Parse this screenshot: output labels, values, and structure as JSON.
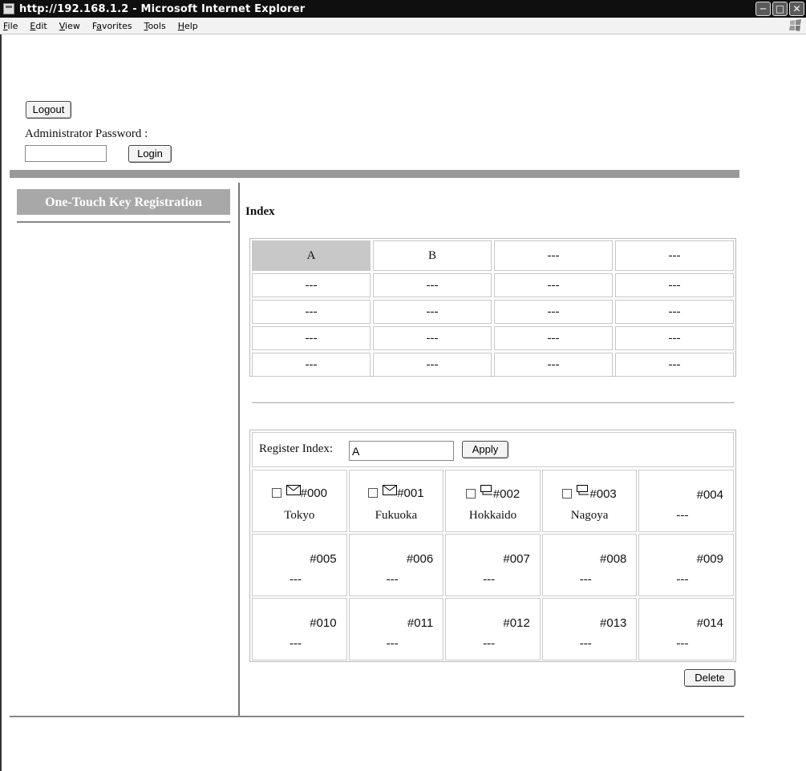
{
  "window": {
    "title": "http://192.168.1.2 - Microsoft Internet Explorer",
    "menu": [
      "File",
      "Edit",
      "View",
      "Favorites",
      "Tools",
      "Help"
    ],
    "menu_underline": [
      "F",
      "E",
      "V",
      "a",
      "T",
      "H"
    ]
  },
  "auth": {
    "logout_label": "Logout",
    "password_label": "Administrator Password :",
    "password_value": "",
    "login_label": "Login"
  },
  "sidebar": {
    "items": [
      {
        "label": "One-Touch Key Registration",
        "active": true
      }
    ]
  },
  "index": {
    "title": "Index",
    "cells": [
      [
        "A",
        "B",
        "---",
        "---"
      ],
      [
        "---",
        "---",
        "---",
        "---"
      ],
      [
        "---",
        "---",
        "---",
        "---"
      ],
      [
        "---",
        "---",
        "---",
        "---"
      ],
      [
        "---",
        "---",
        "---",
        "---"
      ]
    ],
    "selected": "A"
  },
  "register": {
    "index_label": "Register Index:",
    "index_value": "A",
    "apply_label": "Apply",
    "delete_label": "Delete",
    "keys": [
      {
        "number": "#000",
        "name": "Tokyo",
        "icon": "envelope-icon",
        "registered": true
      },
      {
        "number": "#001",
        "name": "Fukuoka",
        "icon": "envelope-icon",
        "registered": true
      },
      {
        "number": "#002",
        "name": "Hokkaido",
        "icon": "computer-icon",
        "registered": true
      },
      {
        "number": "#003",
        "name": "Nagoya",
        "icon": "computer-icon",
        "registered": true
      },
      {
        "number": "#004",
        "name": "---",
        "registered": false
      },
      {
        "number": "#005",
        "name": "---",
        "registered": false
      },
      {
        "number": "#006",
        "name": "---",
        "registered": false
      },
      {
        "number": "#007",
        "name": "---",
        "registered": false
      },
      {
        "number": "#008",
        "name": "---",
        "registered": false
      },
      {
        "number": "#009",
        "name": "---",
        "registered": false
      },
      {
        "number": "#010",
        "name": "---",
        "registered": false
      },
      {
        "number": "#011",
        "name": "---",
        "registered": false
      },
      {
        "number": "#012",
        "name": "---",
        "registered": false
      },
      {
        "number": "#013",
        "name": "---",
        "registered": false
      },
      {
        "number": "#014",
        "name": "---",
        "registered": false
      }
    ]
  }
}
